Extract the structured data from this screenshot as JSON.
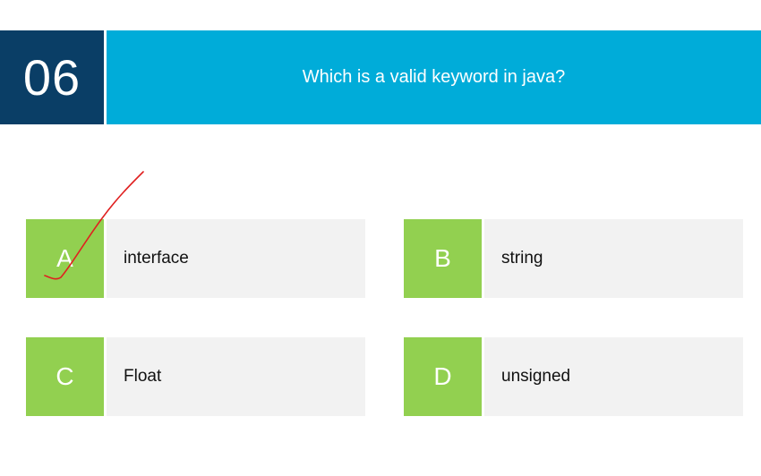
{
  "question": {
    "number": "06",
    "text": "Which is a valid keyword in java?"
  },
  "options": [
    {
      "letter": "A",
      "text": "interface"
    },
    {
      "letter": "B",
      "text": "string"
    },
    {
      "letter": "C",
      "text": "Float"
    },
    {
      "letter": "D",
      "text": "unsigned"
    }
  ],
  "colors": {
    "number_bg": "#0a3e66",
    "question_bg": "#00acd9",
    "letter_bg": "#92d050",
    "option_bg": "#f2f2f2",
    "check_mark": "#e02020"
  },
  "annotation": {
    "type": "hand-drawn check mark",
    "on_option": "A"
  }
}
